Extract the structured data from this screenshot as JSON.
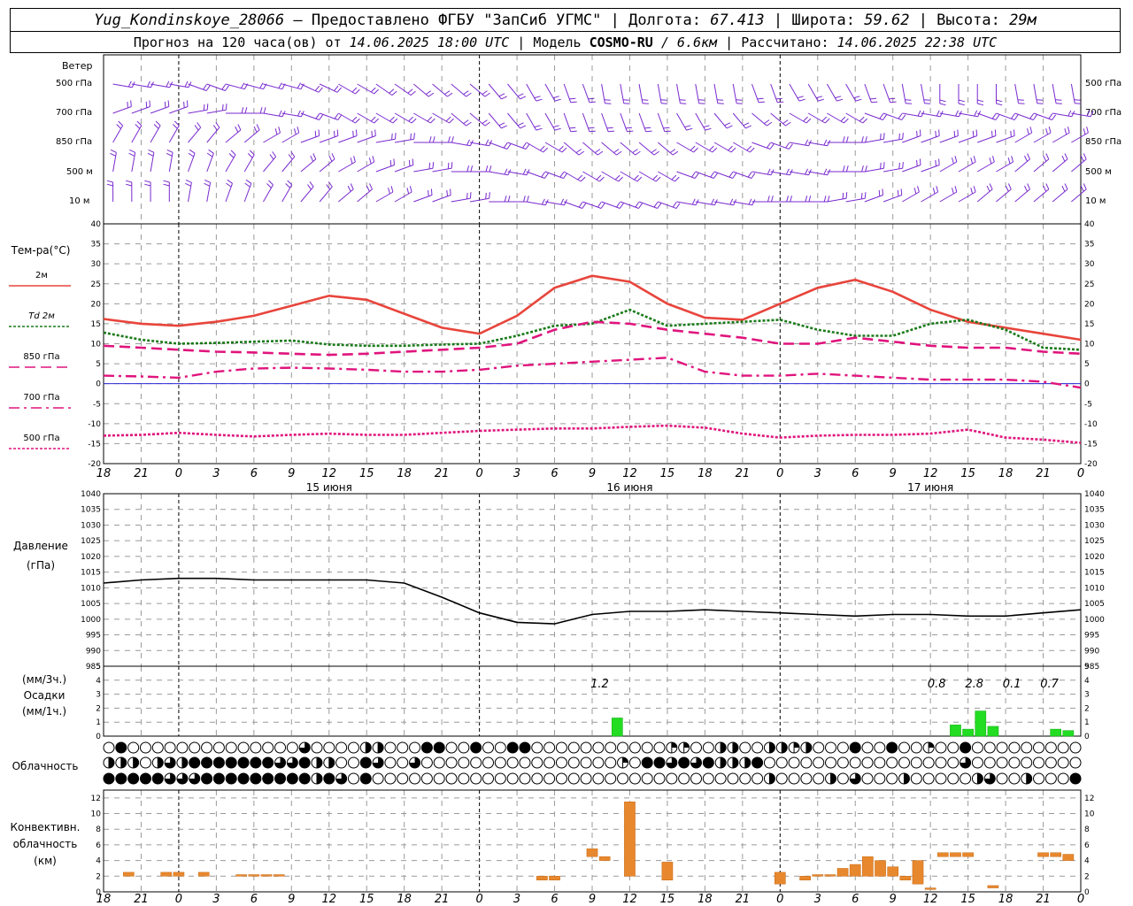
{
  "header": {
    "station": "Yug_Kondinskoye_28066",
    "dash": " – ",
    "provider": "Предоставлено ФГБУ \"ЗапСиб УГМС\"",
    "lon_label": "Долгота:",
    "lon": "67.413",
    "lat_label": "Широта:",
    "lat": "59.62",
    "alt_label": "Высота:",
    "alt": "29м",
    "forecast_prefix": "Прогноз на 120 часа(ов)  от",
    "forecast_start": "14.06.2025 18:00 UTC",
    "model_label": "Модель",
    "model": "COSMO-RU",
    "resolution": "/ 6.6км",
    "computed_label": "Рассчитано:",
    "computed": "14.06.2025 22:38 UTC"
  },
  "panels": {
    "wind": {
      "title": "Ветер",
      "levels": [
        "500 гПа",
        "700 гПа",
        "850 гПа",
        "500 м",
        "10  м"
      ]
    },
    "temperature": {
      "title": "Тем-ра(°C)",
      "legend": [
        {
          "label": "2м",
          "color": "#e8453c",
          "style": "solid"
        },
        {
          "label": "Td  2м",
          "color": "#1a7a1a",
          "style": "dotted"
        },
        {
          "label": "850 гПа",
          "color": "#e0147d",
          "style": "dashed"
        },
        {
          "label": "700 гПа",
          "color": "#e0147d",
          "style": "dashdot"
        },
        {
          "label": "500 гПа",
          "color": "#e0147d",
          "style": "dotted"
        }
      ],
      "y_ticks": [
        "40",
        "35",
        "30",
        "25",
        "20",
        "15",
        "10",
        "5",
        "0",
        "-5",
        "-10",
        "-15",
        "-20"
      ]
    },
    "pressure": {
      "title_line1": "Давление",
      "title_line2": "(гПа)",
      "y_ticks": [
        "1040",
        "1035",
        "1030",
        "1025",
        "1020",
        "1015",
        "1010",
        "1005",
        "1000",
        "995",
        "990",
        "985"
      ]
    },
    "precipitation": {
      "unit3h": "(мм/3ч.)",
      "title": "Осадки",
      "unit1h": "(мм/1ч.)",
      "y_ticks": [
        "5",
        "4",
        "3",
        "2",
        "1",
        "0"
      ],
      "totals": [
        "1.2",
        "0.8",
        "2.8",
        "0.1",
        "0.7"
      ]
    },
    "cloudiness": {
      "title": "Облачность"
    },
    "convective": {
      "title_line1": "Конвективн.",
      "title_line2": "облачность",
      "title_line3": "(км)",
      "y_ticks": [
        "12",
        "10",
        "8",
        "6",
        "4",
        "2",
        "0"
      ]
    }
  },
  "time_axis": {
    "ticks": [
      "18",
      "21",
      "0",
      "3",
      "6",
      "9",
      "12",
      "15",
      "18",
      "21",
      "0",
      "3",
      "6",
      "9",
      "12",
      "15",
      "18",
      "21",
      "0",
      "3",
      "6",
      "9",
      "12",
      "15",
      "18",
      "21",
      "0"
    ],
    "days": [
      "15 июня",
      "16 июня",
      "17 июня"
    ]
  },
  "chart_data": {
    "type": "line",
    "x_unit": "hours from 14.06.2025 18:00 UTC",
    "x_range": [
      0,
      78
    ],
    "series": [
      {
        "name": "2м",
        "color": "#e8453c",
        "x": [
          0,
          3,
          6,
          9,
          12,
          15,
          18,
          21,
          24,
          27,
          30,
          33,
          36,
          39,
          42,
          45,
          48,
          51,
          54,
          57,
          60,
          63,
          66,
          69,
          72,
          75,
          78
        ],
        "values": [
          16.2,
          15.0,
          14.5,
          15.5,
          17.0,
          19.5,
          22.0,
          21.0,
          17.5,
          14.0,
          12.5,
          17.0,
          24.0,
          27.0,
          25.5,
          20.0,
          16.5,
          16.0,
          20.0,
          24.0,
          26.0,
          23.0,
          18.5,
          15.5,
          14.0,
          12.5,
          11.0
        ]
      },
      {
        "name": "Td  2м",
        "color": "#1a7a1a",
        "x": [
          0,
          3,
          6,
          9,
          12,
          15,
          18,
          21,
          24,
          27,
          30,
          33,
          36,
          39,
          42,
          45,
          48,
          51,
          54,
          57,
          60,
          63,
          66,
          69,
          72,
          75,
          78
        ],
        "values": [
          12.8,
          11.0,
          10.0,
          10.2,
          10.5,
          10.8,
          9.8,
          9.5,
          9.5,
          9.8,
          10.0,
          12.0,
          14.5,
          15.0,
          18.5,
          14.5,
          15.0,
          15.5,
          16.0,
          13.5,
          12.0,
          12.0,
          15.0,
          16.0,
          13.5,
          9.0,
          8.5
        ]
      },
      {
        "name": "850 гПа",
        "color": "#e0147d",
        "x": [
          0,
          3,
          6,
          9,
          12,
          15,
          18,
          21,
          24,
          27,
          30,
          33,
          36,
          39,
          42,
          45,
          48,
          51,
          54,
          57,
          60,
          63,
          66,
          69,
          72,
          75,
          78
        ],
        "values": [
          9.5,
          9.0,
          8.5,
          8.0,
          7.8,
          7.5,
          7.2,
          7.5,
          8.0,
          8.5,
          9.0,
          10.0,
          13.5,
          15.5,
          15.0,
          13.5,
          12.5,
          11.5,
          10.0,
          10.0,
          11.5,
          10.5,
          9.5,
          9.0,
          9.0,
          8.0,
          7.5
        ]
      },
      {
        "name": "700 гПа",
        "color": "#e0147d",
        "x": [
          0,
          3,
          6,
          9,
          12,
          15,
          18,
          21,
          24,
          27,
          30,
          33,
          36,
          39,
          42,
          45,
          48,
          51,
          54,
          57,
          60,
          63,
          66,
          69,
          72,
          75,
          78
        ],
        "values": [
          2.0,
          1.8,
          1.5,
          3.0,
          3.8,
          4.0,
          3.8,
          3.5,
          3.0,
          3.0,
          3.5,
          4.5,
          5.0,
          5.5,
          6.0,
          6.5,
          3.0,
          2.0,
          2.0,
          2.5,
          2.0,
          1.5,
          1.0,
          1.0,
          1.0,
          0.5,
          -1.0
        ]
      },
      {
        "name": "500 гПа",
        "color": "#e0147d",
        "x": [
          0,
          3,
          6,
          9,
          12,
          15,
          18,
          21,
          24,
          27,
          30,
          33,
          36,
          39,
          42,
          45,
          48,
          51,
          54,
          57,
          60,
          63,
          66,
          69,
          72,
          75,
          78
        ],
        "values": [
          -13.0,
          -12.8,
          -12.3,
          -12.8,
          -13.2,
          -12.8,
          -12.5,
          -12.8,
          -12.8,
          -12.3,
          -11.8,
          -11.5,
          -11.2,
          -11.2,
          -10.8,
          -10.5,
          -11.0,
          -12.5,
          -13.5,
          -13.0,
          -12.8,
          -12.8,
          -12.5,
          -11.5,
          -13.5,
          -14.0,
          -14.8
        ]
      }
    ],
    "temperature_ylim": [
      -20,
      40
    ],
    "pressure": {
      "x": [
        0,
        3,
        6,
        9,
        12,
        15,
        18,
        21,
        24,
        27,
        30,
        33,
        36,
        39,
        42,
        45,
        48,
        51,
        54,
        57,
        60,
        63,
        66,
        69,
        72,
        75,
        78
      ],
      "values": [
        1011.5,
        1012.5,
        1013.0,
        1013.0,
        1012.5,
        1012.5,
        1012.5,
        1012.5,
        1011.5,
        1007.0,
        1002.0,
        999.0,
        998.5,
        1001.5,
        1002.5,
        1002.5,
        1003.0,
        1002.5,
        1002.0,
        1001.5,
        1001.0,
        1001.5,
        1001.5,
        1001.0,
        1001.0,
        1002.0,
        1003.0
      ],
      "ylim": [
        985,
        1040
      ]
    },
    "precipitation_1h": {
      "x": [
        41,
        68,
        69,
        70,
        71,
        76,
        77
      ],
      "values": [
        1.3,
        0.8,
        0.5,
        1.8,
        0.7,
        0.5,
        0.4
      ],
      "ylim": [
        0,
        5
      ]
    },
    "convective_cloud_km": {
      "bars": [
        {
          "x": 2,
          "bottom": 2.0,
          "top": 2.5
        },
        {
          "x": 5,
          "bottom": 2.0,
          "top": 2.5
        },
        {
          "x": 6,
          "bottom": 2.0,
          "top": 2.5
        },
        {
          "x": 8,
          "bottom": 2.0,
          "top": 2.5
        },
        {
          "x": 11,
          "bottom": 2.0,
          "top": 2.2
        },
        {
          "x": 12,
          "bottom": 2.0,
          "top": 2.2
        },
        {
          "x": 13,
          "bottom": 2.0,
          "top": 2.2
        },
        {
          "x": 14,
          "bottom": 2.0,
          "top": 2.2
        },
        {
          "x": 35,
          "bottom": 1.5,
          "top": 2.0
        },
        {
          "x": 36,
          "bottom": 1.5,
          "top": 2.0
        },
        {
          "x": 39,
          "bottom": 4.5,
          "top": 5.5
        },
        {
          "x": 40,
          "bottom": 4.0,
          "top": 4.5
        },
        {
          "x": 42,
          "bottom": 2.0,
          "top": 11.5
        },
        {
          "x": 45,
          "bottom": 1.5,
          "top": 3.8
        },
        {
          "x": 54,
          "bottom": 1.0,
          "top": 2.5
        },
        {
          "x": 56,
          "bottom": 1.5,
          "top": 2.0
        },
        {
          "x": 57,
          "bottom": 2.0,
          "top": 2.2
        },
        {
          "x": 58,
          "bottom": 2.0,
          "top": 2.2
        },
        {
          "x": 59,
          "bottom": 2.0,
          "top": 3.0
        },
        {
          "x": 60,
          "bottom": 2.0,
          "top": 3.5
        },
        {
          "x": 61,
          "bottom": 2.0,
          "top": 4.5
        },
        {
          "x": 62,
          "bottom": 2.0,
          "top": 4.0
        },
        {
          "x": 63,
          "bottom": 2.0,
          "top": 3.2
        },
        {
          "x": 64,
          "bottom": 1.5,
          "top": 2.0
        },
        {
          "x": 65,
          "bottom": 1.0,
          "top": 4.0
        },
        {
          "x": 66,
          "bottom": 0.3,
          "top": 0.5
        },
        {
          "x": 67,
          "bottom": 4.5,
          "top": 5.0
        },
        {
          "x": 68,
          "bottom": 4.5,
          "top": 5.0
        },
        {
          "x": 69,
          "bottom": 4.5,
          "top": 5.0
        },
        {
          "x": 71,
          "bottom": 0.5,
          "top": 0.8
        },
        {
          "x": 75,
          "bottom": 4.5,
          "top": 5.0
        },
        {
          "x": 76,
          "bottom": 4.5,
          "top": 5.0
        },
        {
          "x": 77,
          "bottom": 4.0,
          "top": 4.8
        }
      ],
      "ylim": [
        0,
        13
      ]
    },
    "cloud_cover_eighths": {
      "rows": [
        [
          0,
          8,
          0,
          0,
          0,
          0,
          0,
          0,
          0,
          0,
          0,
          0,
          0,
          0,
          0,
          0,
          6,
          0,
          0,
          0,
          0,
          4,
          4,
          0,
          0,
          0,
          8,
          8,
          0,
          0,
          8,
          0,
          0,
          8,
          8,
          0,
          0,
          0,
          0,
          0,
          0,
          0,
          0,
          0,
          0,
          0,
          2,
          2,
          0,
          0,
          4,
          4,
          0,
          0,
          4,
          4,
          2,
          4,
          0,
          0,
          0,
          8,
          0,
          0,
          8,
          0,
          0,
          2,
          0,
          0,
          8,
          0,
          0,
          0,
          0,
          0,
          0,
          0,
          0,
          0
        ],
        [
          4,
          4,
          4,
          0,
          4,
          6,
          4,
          8,
          8,
          8,
          8,
          8,
          8,
          8,
          6,
          6,
          8,
          4,
          4,
          0,
          0,
          8,
          6,
          0,
          0,
          6,
          0,
          0,
          0,
          0,
          0,
          0,
          0,
          0,
          0,
          0,
          0,
          0,
          0,
          0,
          0,
          0,
          2,
          0,
          8,
          8,
          6,
          8,
          6,
          8,
          4,
          4,
          4,
          8,
          0,
          0,
          0,
          0,
          0,
          0,
          0,
          0,
          0,
          0,
          0,
          0,
          0,
          0,
          0,
          0,
          6,
          0,
          0,
          0,
          0,
          0,
          0,
          0,
          0,
          0
        ],
        [
          8,
          8,
          8,
          8,
          8,
          6,
          6,
          6,
          8,
          8,
          8,
          8,
          8,
          8,
          8,
          8,
          8,
          4,
          8,
          6,
          0,
          8,
          0,
          0,
          0,
          0,
          0,
          0,
          0,
          0,
          0,
          0,
          0,
          0,
          0,
          0,
          0,
          0,
          0,
          0,
          0,
          0,
          0,
          0,
          0,
          0,
          0,
          0,
          0,
          0,
          0,
          0,
          0,
          0,
          4,
          0,
          0,
          0,
          0,
          4,
          0,
          6,
          0,
          0,
          0,
          4,
          0,
          0,
          0,
          0,
          0,
          4,
          6,
          0,
          0,
          4,
          0,
          0,
          0,
          8
        ]
      ]
    }
  }
}
